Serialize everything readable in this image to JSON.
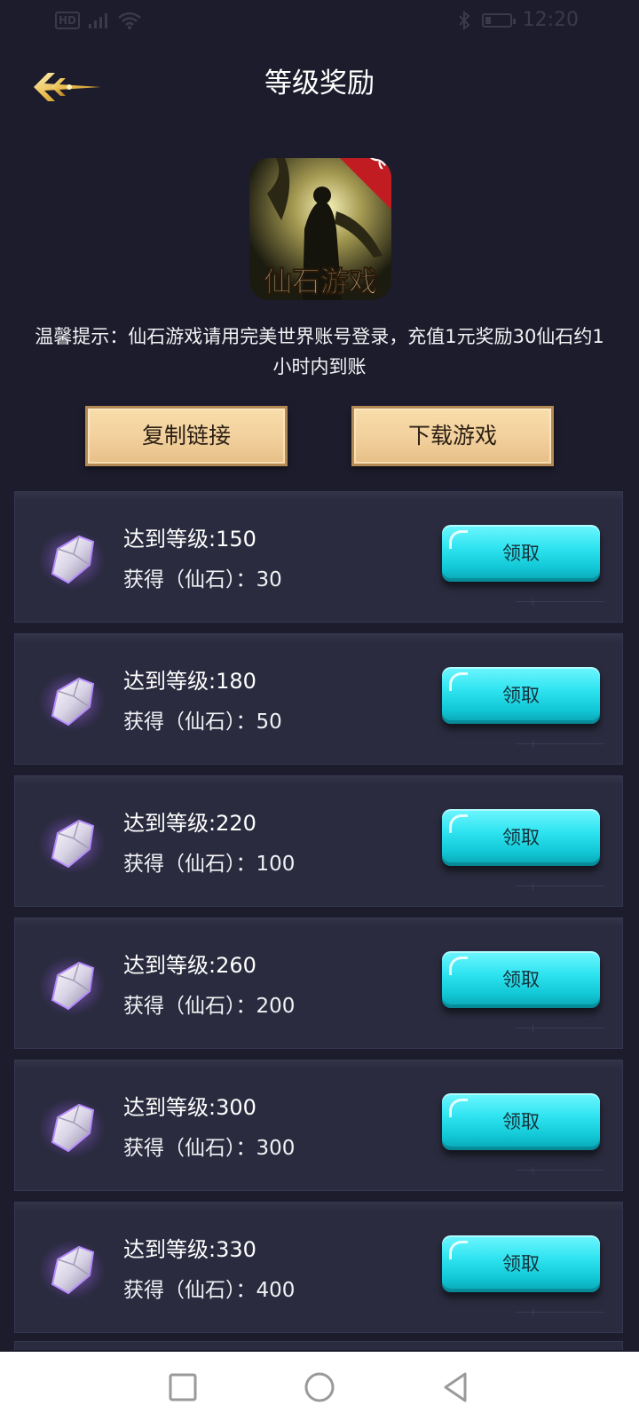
{
  "status_bar": {
    "network_badge": "HD",
    "time": "12:20",
    "icons": [
      "signal-icon",
      "wifi-icon",
      "bluetooth-icon",
      "battery-icon"
    ]
  },
  "header": {
    "title": "等级奖励",
    "back_icon": "back-arrow-icon"
  },
  "game": {
    "logo_title": "仙石游戏",
    "logo_badge": "完美",
    "tip": "温馨提示：仙石游戏请用完美世界账号登录，充值1元奖励30仙石约1小时内到账",
    "copy_link_label": "复制链接",
    "download_label": "下载游戏"
  },
  "rewards": [
    {
      "level_text": "达到等级:150",
      "gain_text": "获得（仙石）：30",
      "claim_label": "领取"
    },
    {
      "level_text": "达到等级:180",
      "gain_text": "获得（仙石）：50",
      "claim_label": "领取"
    },
    {
      "level_text": "达到等级:220",
      "gain_text": "获得（仙石）：100",
      "claim_label": "领取"
    },
    {
      "level_text": "达到等级:260",
      "gain_text": "获得（仙石）：200",
      "claim_label": "领取"
    },
    {
      "level_text": "达到等级:300",
      "gain_text": "获得（仙石）：300",
      "claim_label": "领取"
    },
    {
      "level_text": "达到等级:330",
      "gain_text": "获得（仙石）：400",
      "claim_label": "领取"
    }
  ],
  "colors": {
    "background": "#1c1c2c",
    "card": "#2a2b3e",
    "gold_button": "#f2d19e",
    "claim_button": "#2fe4f0"
  },
  "nav_bar": {
    "icons": [
      "recent-apps-icon",
      "home-icon",
      "back-icon"
    ]
  }
}
